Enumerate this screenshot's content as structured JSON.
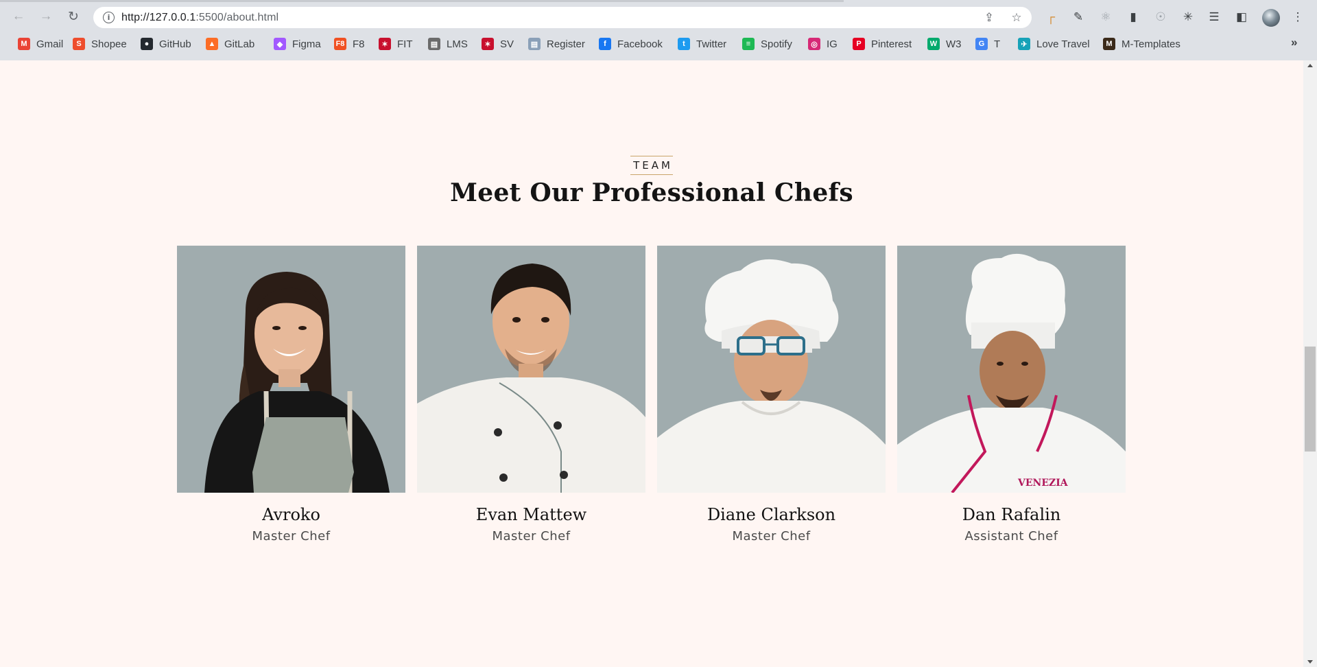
{
  "browser": {
    "url_host": "http://127.0.0.1",
    "url_path": ":5500/about.html",
    "bookmarks": [
      {
        "label": "Gmail",
        "icon": "gmail-icon",
        "color": "#ea4335"
      },
      {
        "label": "Shopee",
        "icon": "shopee-icon",
        "color": "#ee4d2d"
      },
      {
        "label": "GitHub",
        "icon": "github-icon",
        "color": "#24292f"
      },
      {
        "label": "GitLab",
        "icon": "gitlab-icon",
        "color": "#fc6d26"
      },
      {
        "label": "Figma",
        "icon": "figma-icon",
        "color": "#a259ff"
      },
      {
        "label": "F8",
        "icon": "f8-icon",
        "color": "#f05123"
      },
      {
        "label": "FIT",
        "icon": "fit-icon",
        "color": "#c8102e"
      },
      {
        "label": "LMS",
        "icon": "lms-icon",
        "color": "#6b6b6b"
      },
      {
        "label": "SV",
        "icon": "sv-icon",
        "color": "#c8102e"
      },
      {
        "label": "Register",
        "icon": "register-icon",
        "color": "#8aa0b8"
      },
      {
        "label": "Facebook",
        "icon": "facebook-icon",
        "color": "#1877f2"
      },
      {
        "label": "Twitter",
        "icon": "twitter-icon",
        "color": "#1d9bf0"
      },
      {
        "label": "Spotify",
        "icon": "spotify-icon",
        "color": "#1db954"
      },
      {
        "label": "IG",
        "icon": "instagram-icon",
        "color": "#d62976"
      },
      {
        "label": "Pinterest",
        "icon": "pinterest-icon",
        "color": "#e60023"
      },
      {
        "label": "W3",
        "icon": "w3schools-icon",
        "color": "#04aa6d"
      },
      {
        "label": "T",
        "icon": "translate-icon",
        "color": "#4285f4"
      },
      {
        "label": "Love Travel",
        "icon": "love-travel-icon",
        "color": "#17a2b8"
      },
      {
        "label": "M-Templates",
        "icon": "m-templates-icon",
        "color": "#3b2a1a"
      }
    ],
    "more_label": "»"
  },
  "section": {
    "eyebrow": "TEAM",
    "heading": "Meet Our Professional Chefs"
  },
  "chefs": [
    {
      "name": "Avroko",
      "role": "Master Chef"
    },
    {
      "name": "Evan Mattew",
      "role": "Master Chef"
    },
    {
      "name": "Diane Clarkson",
      "role": "Master Chef"
    },
    {
      "name": "Dan Rafalin",
      "role": "Assistant Chef"
    }
  ],
  "colors": {
    "page_bg": "#fff6f3",
    "photo_bg": "#a0acae",
    "accent_rule": "#c9a46a"
  }
}
